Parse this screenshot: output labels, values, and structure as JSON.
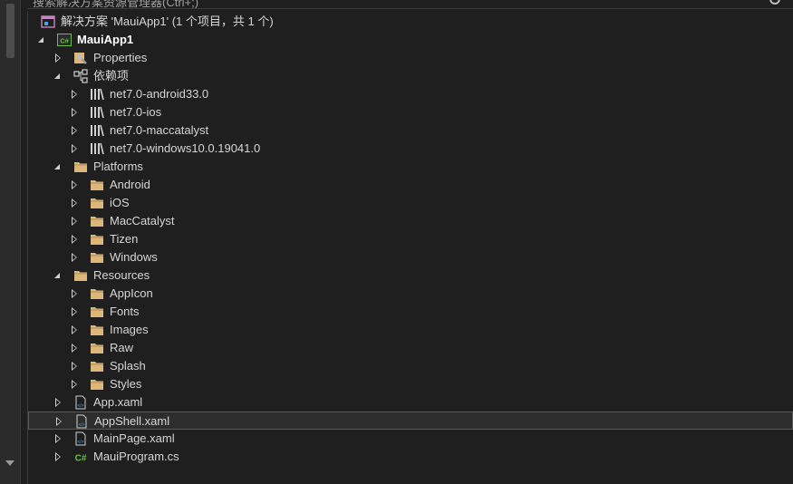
{
  "search": {
    "placeholder": "搜索解决方案资源管理器(Ctrl+;)"
  },
  "solution": {
    "label": "解决方案 'MauiApp1' (1 个项目，共 1 个)"
  },
  "project": {
    "label": "MauiApp1",
    "icon": "csharp-project-icon"
  },
  "nodes": {
    "properties": "Properties",
    "dependencies": "依赖项",
    "dep_android": "net7.0-android33.0",
    "dep_ios": "net7.0-ios",
    "dep_maccatalyst": "net7.0-maccatalyst",
    "dep_windows": "net7.0-windows10.0.19041.0",
    "platforms": "Platforms",
    "android": "Android",
    "ios": "iOS",
    "maccatalyst": "MacCatalyst",
    "tizen": "Tizen",
    "windows": "Windows",
    "resources": "Resources",
    "appicon": "AppIcon",
    "fonts": "Fonts",
    "images": "Images",
    "raw": "Raw",
    "splash": "Splash",
    "styles": "Styles",
    "app_xaml": "App.xaml",
    "appshell_xaml": "AppShell.xaml",
    "mainpage_xaml": "MainPage.xaml",
    "mauiprogram_cs": "MauiProgram.cs"
  },
  "colors": {
    "folder": "#dcb67a",
    "csharp": "#68c04a",
    "solution": "#c586c0",
    "selection": "#2d2d2d"
  }
}
